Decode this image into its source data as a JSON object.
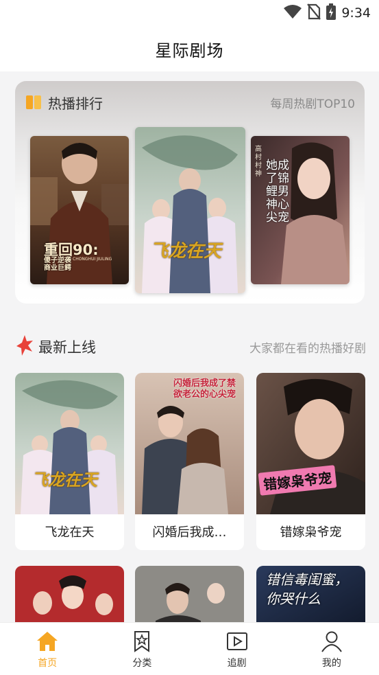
{
  "status_bar": {
    "time": "9:34",
    "icons": [
      "wifi-icon",
      "no-sim-icon",
      "battery-charging-icon"
    ]
  },
  "header": {
    "title": "星际剧场"
  },
  "hot": {
    "title": "热播排行",
    "subtitle": "每周热剧TOP10",
    "icon": "book-icon",
    "posters": [
      {
        "title_text": "重回90:",
        "subtitle_text": "傻子逆袭商业巨鳄",
        "roman": "CHONGHUI JIULING"
      },
      {
        "title_text": "飞龙在天"
      },
      {
        "title_text": "她成了锦鲤男神心尖宠",
        "side_text": "高村村神"
      }
    ]
  },
  "new": {
    "title": "最新上线",
    "subtitle": "大家都在看的热播好剧",
    "icon": "star-burst-icon",
    "items": [
      {
        "name": "飞龙在天",
        "poster_text": "飞龙在天"
      },
      {
        "name": "闪婚后我成…",
        "poster_text": "闪婚后我成了禁欲老公的心尖宠"
      },
      {
        "name": "错嫁枭爷宠",
        "poster_text": "错嫁枭爷宠"
      }
    ],
    "partial_items": [
      {
        "poster_text": ""
      },
      {
        "poster_text": ""
      },
      {
        "poster_text": "错信毒闺蜜，你哭什么"
      }
    ]
  },
  "nav": [
    {
      "label": "首页",
      "icon": "home-icon",
      "active": true
    },
    {
      "label": "分类",
      "icon": "category-star-icon",
      "active": false
    },
    {
      "label": "追剧",
      "icon": "play-icon",
      "active": false
    },
    {
      "label": "我的",
      "icon": "user-icon",
      "active": false
    }
  ],
  "colors": {
    "accent": "#f5a623",
    "background": "#f4f4f5",
    "card": "#ffffff",
    "hot_icon": "#f5a623",
    "new_icon": "#e8423a"
  }
}
